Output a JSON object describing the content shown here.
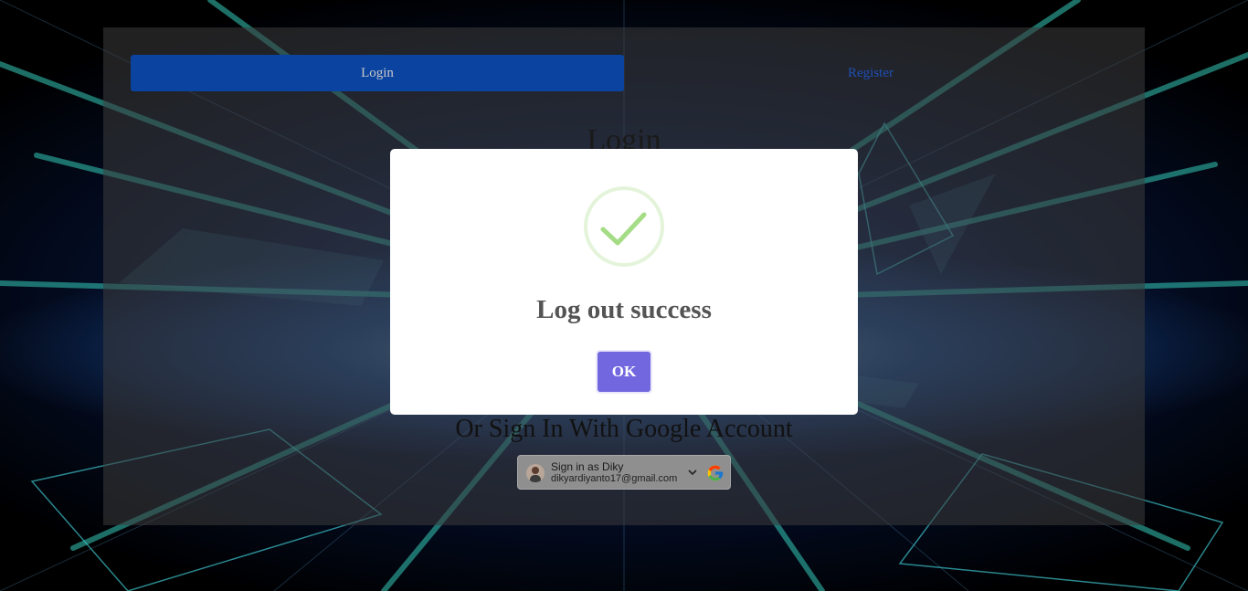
{
  "tabs": {
    "login_label": "Login",
    "register_label": "Register"
  },
  "form": {
    "title": "Login",
    "google_heading": "Or Sign In With Google Account"
  },
  "google_signin": {
    "name_line": "Sign in as Diky",
    "email": "dikyardiyanto17@gmail.com",
    "icon": "google-logo-icon"
  },
  "modal": {
    "icon": "success-check-icon",
    "title": "Log out success",
    "ok_label": "OK"
  },
  "colors": {
    "tab_active": "#0a43a0",
    "ok_button": "#7367e0",
    "success_check": "#a5dc86"
  }
}
